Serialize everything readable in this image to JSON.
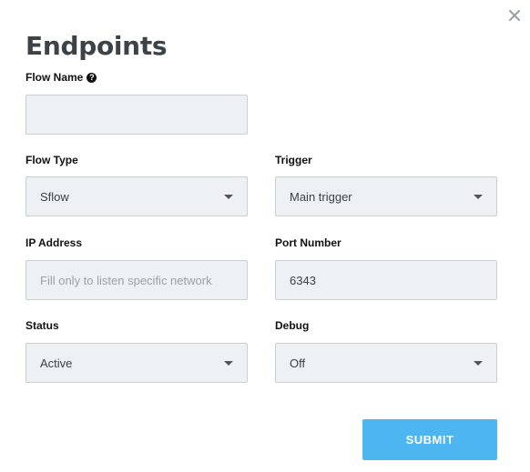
{
  "dialog": {
    "title": "Endpoints",
    "close_icon": "close-icon"
  },
  "form": {
    "flow_name": {
      "label": "Flow Name",
      "value": "",
      "placeholder": "",
      "help_icon": "help-icon"
    },
    "flow_type": {
      "label": "Flow Type",
      "value": "Sflow"
    },
    "trigger": {
      "label": "Trigger",
      "value": "Main trigger"
    },
    "ip_address": {
      "label": "IP Address",
      "value": "",
      "placeholder": "Fill only to listen specific network"
    },
    "port_number": {
      "label": "Port Number",
      "value": "6343"
    },
    "status": {
      "label": "Status",
      "value": "Active"
    },
    "debug": {
      "label": "Debug",
      "value": "Off"
    }
  },
  "actions": {
    "submit_label": "SUBMIT"
  },
  "colors": {
    "submit_bg": "#4db6f0",
    "field_bg": "#eef1f4",
    "title": "#3b4248"
  }
}
